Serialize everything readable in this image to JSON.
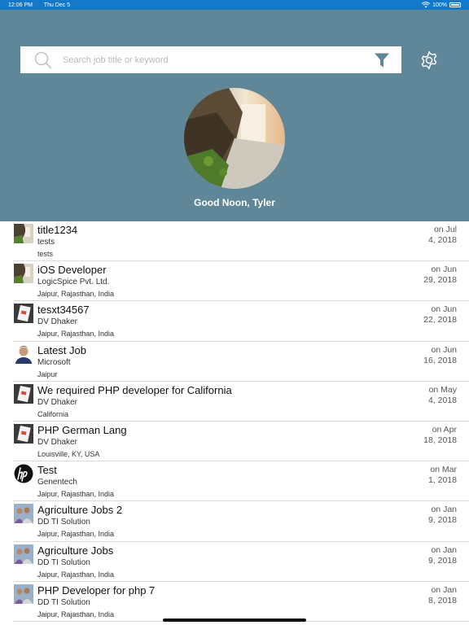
{
  "status_bar": {
    "time": "12:06 PM",
    "date": "Thu Dec 5",
    "battery": "100%"
  },
  "search": {
    "placeholder": "Search job title or keyword"
  },
  "header": {
    "greeting": "Good Noon, Tyler"
  },
  "jobs": [
    {
      "title": "title1234",
      "company": "tests",
      "location": "tests",
      "date_line1": "on Jul",
      "date_line2": "4, 2018",
      "thumb": "waterfall"
    },
    {
      "title": "iOS Developer",
      "company": "LogicSpice Pvt. Ltd.",
      "location": "Jaipur, Rajasthan, India",
      "date_line1": "on Jun",
      "date_line2": "29, 2018",
      "thumb": "waterfall"
    },
    {
      "title": "tesxt34567",
      "company": "DV Dhaker",
      "location": "Jaipur, Rajasthan, India",
      "date_line1": "on Jun",
      "date_line2": "22, 2018",
      "thumb": "card"
    },
    {
      "title": "Latest Job",
      "company": "Microsoft",
      "location": "Jaipur",
      "date_line1": "on Jun",
      "date_line2": "16, 2018",
      "thumb": "person"
    },
    {
      "title": "We required PHP developer for California",
      "company": "DV Dhaker",
      "location": "California",
      "date_line1": "on May",
      "date_line2": "4, 2018",
      "thumb": "card"
    },
    {
      "title": "PHP German Lang",
      "company": "DV Dhaker",
      "location": "Louisville, KY, USA",
      "date_line1": "on Apr",
      "date_line2": "18, 2018",
      "thumb": "card"
    },
    {
      "title": "Test",
      "company": "Genentech",
      "location": "Jaipur, Rajasthan, India",
      "date_line1": "on Mar",
      "date_line2": "1, 2018",
      "thumb": "hp-logo"
    },
    {
      "title": "Agriculture Jobs 2",
      "company": "DD TI Solution",
      "location": "Jaipur, Rajasthan, India",
      "date_line1": "on Jan",
      "date_line2": "9, 2018",
      "thumb": "group"
    },
    {
      "title": "Agriculture Jobs",
      "company": "DD TI Solution",
      "location": "Jaipur, Rajasthan, India",
      "date_line1": "on Jan",
      "date_line2": "9, 2018",
      "thumb": "group"
    },
    {
      "title": "PHP Developer for php 7",
      "company": "DD TI Solution",
      "location": "Jaipur, Rajasthan, India",
      "date_line1": "on Jan",
      "date_line2": "8, 2018",
      "thumb": "group"
    }
  ],
  "colors": {
    "status_bar": "#1478c8",
    "header": "#5f8797",
    "filter_icon": "#5f8797"
  }
}
